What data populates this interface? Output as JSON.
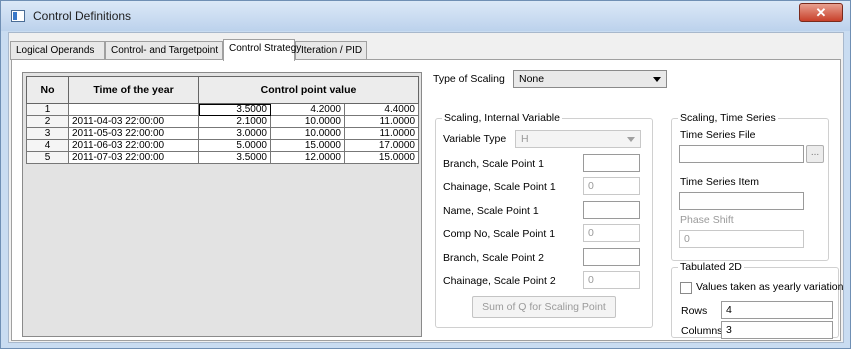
{
  "window": {
    "title": "Control Definitions",
    "close_glyph": "✕"
  },
  "tabs": [
    {
      "label": "Logical Operands"
    },
    {
      "label": "Control- and Targetpoint"
    },
    {
      "label": "Control Strategy"
    },
    {
      "label": "Iteration / PID"
    }
  ],
  "grid": {
    "headers": {
      "no": "No",
      "time": "Time of the year",
      "value": "Control point value"
    },
    "rows": [
      {
        "no": "1",
        "time": "",
        "v1": "3.5000",
        "v2": "4.2000",
        "v3": "4.4000"
      },
      {
        "no": "2",
        "time": "2011-04-03 22:00:00",
        "v1": "2.1000",
        "v2": "10.0000",
        "v3": "11.0000"
      },
      {
        "no": "3",
        "time": "2011-05-03 22:00:00",
        "v1": "3.0000",
        "v2": "10.0000",
        "v3": "11.0000"
      },
      {
        "no": "4",
        "time": "2011-06-03 22:00:00",
        "v1": "5.0000",
        "v2": "15.0000",
        "v3": "17.0000"
      },
      {
        "no": "5",
        "time": "2011-07-03 22:00:00",
        "v1": "3.5000",
        "v2": "12.0000",
        "v3": "15.0000"
      }
    ]
  },
  "scaling": {
    "type_label": "Type of Scaling",
    "type_value": "None"
  },
  "internal": {
    "legend": "Scaling, Internal Variable",
    "variable_type_label": "Variable Type",
    "variable_type_value": "H",
    "branch1_label": "Branch, Scale Point 1",
    "branch1_value": "",
    "chainage1_label": "Chainage, Scale Point 1",
    "chainage1_value": "0",
    "name1_label": "Name, Scale Point 1",
    "name1_value": "",
    "comp1_label": "Comp No, Scale Point 1",
    "comp1_value": "0",
    "branch2_label": "Branch, Scale Point 2",
    "branch2_value": "",
    "chainage2_label": "Chainage, Scale Point 2",
    "chainage2_value": "0",
    "sum_button": "Sum of Q for Scaling Point"
  },
  "timeseries": {
    "legend": "Scaling, Time Series",
    "file_label": "Time Series File",
    "file_value": "",
    "browse_label": "...",
    "item_label": "Time Series Item",
    "item_value": "",
    "phase_label": "Phase Shift",
    "phase_value": "0"
  },
  "tab2d": {
    "legend": "Tabulated 2D",
    "yearly_label": "Values taken as yearly variation",
    "yearly_checked": false,
    "rows_label": "Rows",
    "rows_value": "4",
    "cols_label": "Columns",
    "cols_value": "3"
  }
}
